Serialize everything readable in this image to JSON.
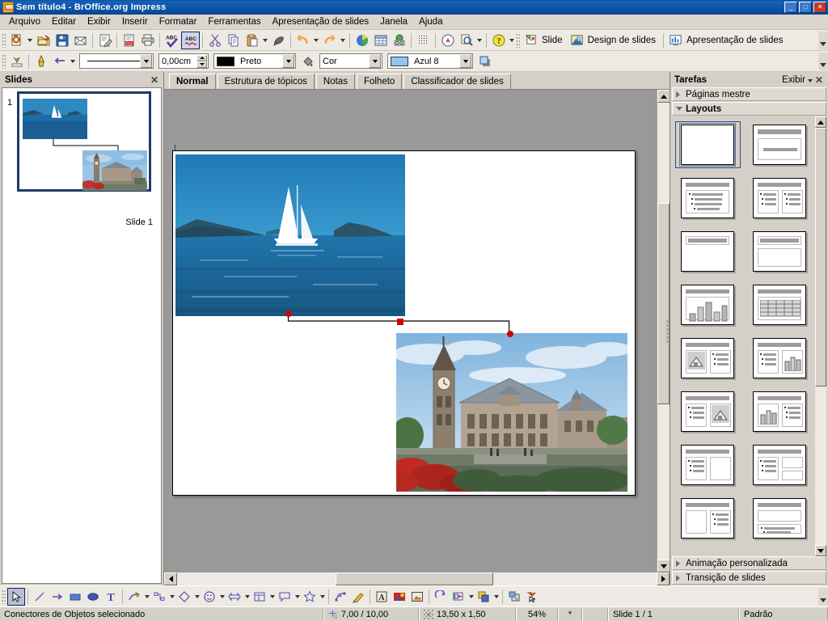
{
  "window": {
    "title": "Sem título4 - BrOffice.org Impress",
    "app_icon": "impress-app-icon",
    "minimize": "_",
    "maximize": "□",
    "close": "✕"
  },
  "menubar": {
    "items": [
      {
        "label": "Arquivo"
      },
      {
        "label": "Editar"
      },
      {
        "label": "Exibir"
      },
      {
        "label": "Inserir"
      },
      {
        "label": "Formatar"
      },
      {
        "label": "Ferramentas"
      },
      {
        "label": "Apresentação de slides"
      },
      {
        "label": "Janela"
      },
      {
        "label": "Ajuda"
      }
    ]
  },
  "standard_toolbar": {
    "buttons": [
      {
        "name": "new-document-icon",
        "tip": "Novo"
      },
      {
        "name": "open-document-icon",
        "tip": "Abrir"
      },
      {
        "name": "save-icon",
        "tip": "Salvar"
      },
      {
        "name": "email-document-icon",
        "tip": "Documento como e-mail"
      },
      {
        "name": "edit-file-icon",
        "tip": "Editar arquivo"
      },
      {
        "name": "export-pdf-icon",
        "tip": "Exportar diretamente como PDF"
      },
      {
        "name": "print-icon",
        "tip": "Imprimir arquivo diretamente"
      },
      {
        "name": "spellcheck-icon",
        "tip": "Verificação ortográfica"
      },
      {
        "name": "autospellcheck-icon",
        "tip": "Verificação ortográfica automática",
        "pressed": true
      },
      {
        "name": "cut-icon",
        "tip": "Cortar"
      },
      {
        "name": "copy-icon",
        "tip": "Copiar"
      },
      {
        "name": "paste-icon",
        "tip": "Colar"
      },
      {
        "name": "clone-formatting-icon",
        "tip": "Clonar formatação"
      },
      {
        "name": "undo-icon",
        "tip": "Desfazer"
      },
      {
        "name": "redo-icon",
        "tip": "Refazer"
      },
      {
        "name": "insert-chart-icon",
        "tip": "Gráfico"
      },
      {
        "name": "insert-table-icon",
        "tip": "Tabela"
      },
      {
        "name": "gallery-icon",
        "tip": "Galeria"
      },
      {
        "name": "display-grid-icon",
        "tip": "Exibir grade"
      },
      {
        "name": "navigator-icon",
        "tip": "Navegador"
      },
      {
        "name": "zoom-icon",
        "tip": "Zoom"
      },
      {
        "name": "help-icon",
        "tip": "Ajuda do BrOffice.org"
      }
    ],
    "presentation_buttons": [
      {
        "name": "new-slide-icon",
        "label": "Slide"
      },
      {
        "name": "slide-design-icon",
        "label": "Design de slides"
      },
      {
        "name": "start-slideshow-icon",
        "label": "Apresentação de slides"
      }
    ]
  },
  "line_fill_toolbar": {
    "buttons": [
      {
        "name": "line-fill-style-icon",
        "tip": "Estilo"
      },
      {
        "name": "line-endpoint-icon",
        "tip": "Pontos de colagem"
      },
      {
        "name": "arrow-style-icon",
        "tip": "Estilo de seta"
      },
      {
        "name": "shadow-icon",
        "tip": "Sombra"
      }
    ],
    "line_style": {
      "value": "———————",
      "name": "line-style-combo"
    },
    "line_width": {
      "value": "0,00cm",
      "name": "line-width-spinner"
    },
    "line_color": {
      "value": "Preto",
      "swatch": "#000000",
      "name": "line-color-combo"
    },
    "area_style": {
      "value": "Cor",
      "name": "area-style-combo"
    },
    "fill_color": {
      "value": "Azul 8",
      "swatch": "#92c5ee",
      "name": "fill-color-combo"
    },
    "shadow_button": {
      "name": "area-shadow-icon"
    }
  },
  "slides_panel": {
    "title": "Slides",
    "close": "✕",
    "slides": [
      {
        "number": "1",
        "caption": "Slide 1",
        "selected": true
      }
    ]
  },
  "view_tabs": {
    "tabs": [
      {
        "label": "Normal",
        "active": true
      },
      {
        "label": "Estrutura de tópicos",
        "active": false
      },
      {
        "label": "Notas",
        "active": false
      },
      {
        "label": "Folheto",
        "active": false
      },
      {
        "label": "Classificador de slides",
        "active": false
      }
    ]
  },
  "canvas": {
    "objects": [
      {
        "name": "sailboat-photo",
        "kind": "image",
        "alt": "Veleiro branco em mar azul com ilhas ao fundo"
      },
      {
        "name": "palace-photo",
        "kind": "image",
        "alt": "Palácio da Paz com torre de relógio e jardim florido"
      },
      {
        "name": "object-connector",
        "kind": "connector",
        "selected": true,
        "handles": [
          "start-handle",
          "mid-handle",
          "end-handle"
        ],
        "handle_color": "#d40000"
      }
    ]
  },
  "tasks_panel": {
    "title": "Tarefas",
    "view_label": "Exibir",
    "close": "✕",
    "sections": [
      {
        "label": "Páginas mestre",
        "expanded": false
      },
      {
        "label": "Layouts",
        "expanded": true
      },
      {
        "label": "Animação personalizada",
        "expanded": false
      },
      {
        "label": "Transição de slides",
        "expanded": false
      }
    ],
    "layouts": [
      {
        "name": "layout-blank",
        "type": "blank",
        "selected": true
      },
      {
        "name": "layout-title-content",
        "type": "title-subtitle"
      },
      {
        "name": "layout-title-bullets",
        "type": "title-bullets"
      },
      {
        "name": "layout-two-content",
        "type": "two-bullets"
      },
      {
        "name": "layout-title-only",
        "type": "title-only"
      },
      {
        "name": "layout-title-empty-box",
        "type": "title-box"
      },
      {
        "name": "layout-title-chart",
        "type": "chart"
      },
      {
        "name": "layout-title-table",
        "type": "table"
      },
      {
        "name": "layout-clip-text",
        "type": "clip-bullets"
      },
      {
        "name": "layout-text-chart",
        "type": "bullets-chart"
      },
      {
        "name": "layout-text-clip",
        "type": "bullets-clip"
      },
      {
        "name": "layout-chart-text",
        "type": "chart-bullets"
      },
      {
        "name": "layout-text-box",
        "type": "bullets-box"
      },
      {
        "name": "layout-text-two-box",
        "type": "bullets-two-box"
      },
      {
        "name": "layout-box-text",
        "type": "box-bullets"
      },
      {
        "name": "layout-two-rows",
        "type": "two-rows"
      }
    ]
  },
  "drawing_toolbar": {
    "buttons": [
      {
        "name": "select-tool-icon",
        "tip": "Seleção",
        "pressed": true
      },
      {
        "name": "line-tool-icon",
        "tip": "Linha"
      },
      {
        "name": "arrow-line-tool-icon",
        "tip": "Linha que termina em seta"
      },
      {
        "name": "rectangle-tool-icon",
        "tip": "Retângulo"
      },
      {
        "name": "ellipse-tool-icon",
        "tip": "Elipse"
      },
      {
        "name": "text-tool-icon",
        "tip": "Texto"
      },
      {
        "name": "curve-tool-icon",
        "tip": "Curva",
        "dropdown": true
      },
      {
        "name": "connector-tool-icon",
        "tip": "Conectores",
        "dropdown": true
      },
      {
        "name": "basic-shapes-icon",
        "tip": "Formas simples",
        "dropdown": true
      },
      {
        "name": "symbol-shapes-icon",
        "tip": "Formas de símbolos",
        "dropdown": true
      },
      {
        "name": "block-arrows-icon",
        "tip": "Setas cheias",
        "dropdown": true
      },
      {
        "name": "flowchart-shapes-icon",
        "tip": "Fluxogramas",
        "dropdown": true
      },
      {
        "name": "callout-shapes-icon",
        "tip": "Textos explicativos",
        "dropdown": true
      },
      {
        "name": "stars-shapes-icon",
        "tip": "Estrelas",
        "dropdown": true
      },
      {
        "name": "points-edit-icon",
        "tip": "Pontos"
      },
      {
        "name": "glue-points-icon",
        "tip": "Pontos de colagem"
      },
      {
        "name": "fontwork-icon",
        "tip": "Galeria do Fontwork"
      },
      {
        "name": "insert-image-icon",
        "tip": "A partir de um arquivo"
      },
      {
        "name": "gallery-shapes-icon",
        "tip": "Galeria"
      },
      {
        "name": "rotate-icon",
        "tip": "Girar"
      },
      {
        "name": "align-icon",
        "tip": "Alinhamento",
        "dropdown": true
      },
      {
        "name": "arrange-icon",
        "tip": "Disposição",
        "dropdown": true
      },
      {
        "name": "interaction-icon",
        "tip": "Interação"
      },
      {
        "name": "show-glue-icon",
        "tip": "Exibir função de pontos de colagem"
      }
    ]
  },
  "statusbar": {
    "selection_info": "Conectores de Objetos selecionado",
    "position": "7,00 / 10,00",
    "size": "13,50 x 1,50",
    "zoom": "54%",
    "modified": "*",
    "signature": "",
    "slide_info": "Slide 1 / 1",
    "master": "Padrão",
    "position_icon": "cursor-position-icon",
    "size_icon": "object-size-icon"
  }
}
